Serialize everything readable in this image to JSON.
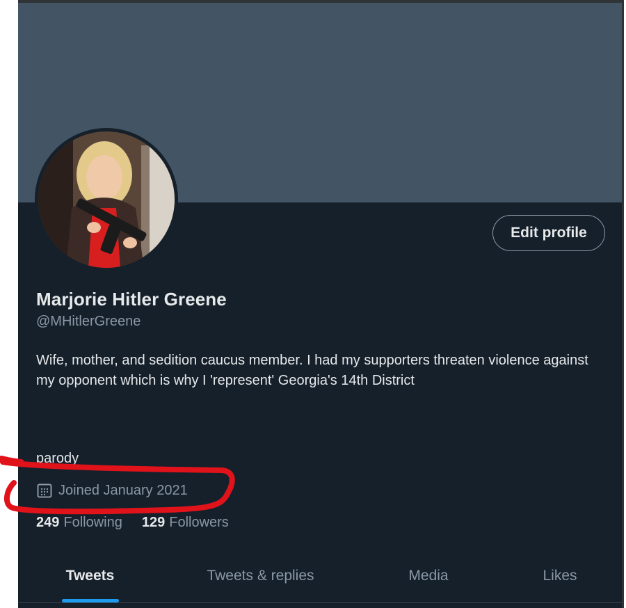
{
  "profile": {
    "name": "Marjorie Hitler Greene",
    "handle": "@MHitlerGreene",
    "bio": "Wife, mother, and sedition caucus member. I had my supporters threaten violence against my opponent which is why I 'represent' Georgia's 14th District",
    "extra": "parody",
    "joined": "Joined January 2021",
    "avatar_alt": "profile-photo"
  },
  "actions": {
    "edit_profile_label": "Edit profile"
  },
  "stats": {
    "following_count": "249",
    "following_label": "Following",
    "followers_count": "129",
    "followers_label": "Followers"
  },
  "tabs": [
    {
      "label": "Tweets",
      "active": true
    },
    {
      "label": "Tweets & replies",
      "active": false
    },
    {
      "label": "Media",
      "active": false
    },
    {
      "label": "Likes",
      "active": false
    }
  ],
  "icons": {
    "calendar": "calendar-icon"
  },
  "colors": {
    "background": "#15202b",
    "banner": "#435464",
    "primary_text": "#e7e9ea",
    "secondary_text": "#8b98a5",
    "accent": "#1d9bf0",
    "annotation": "#e0131b"
  }
}
